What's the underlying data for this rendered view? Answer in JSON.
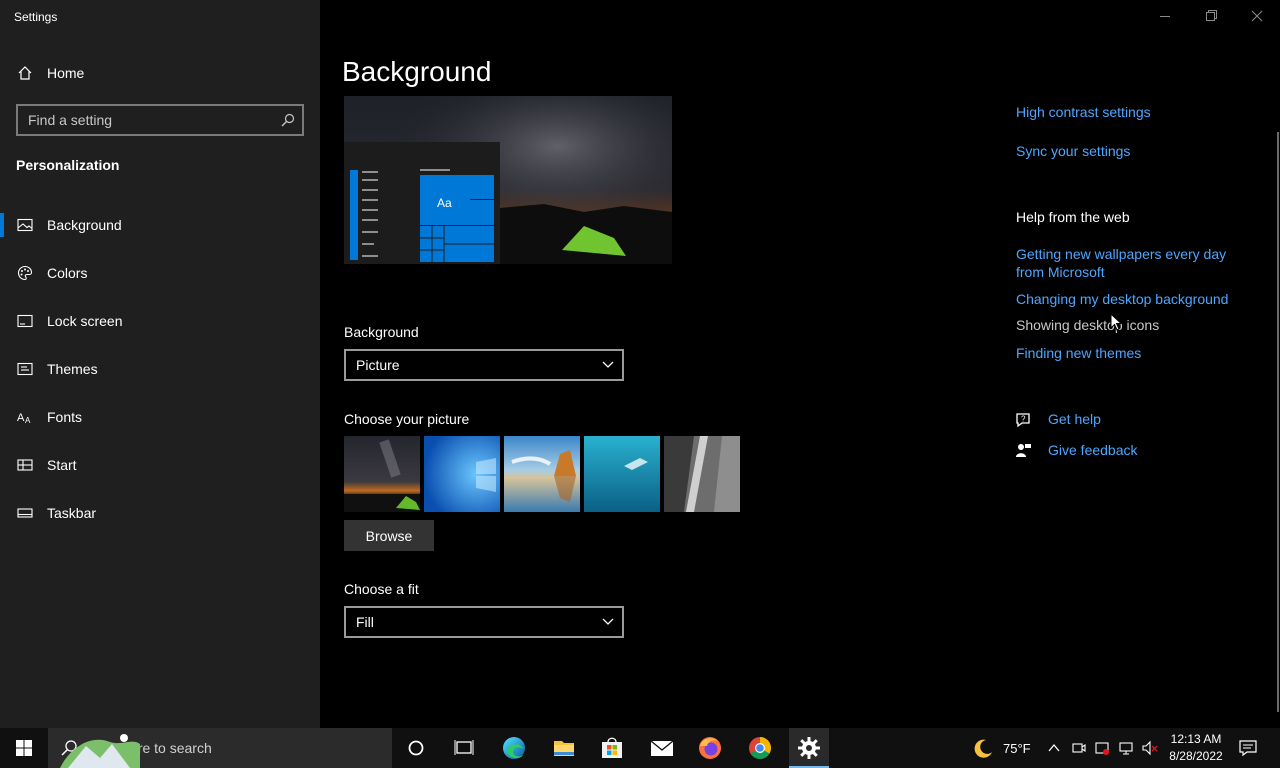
{
  "window": {
    "title": "Settings"
  },
  "sidebar": {
    "home_label": "Home",
    "search_placeholder": "Find a setting",
    "section_title": "Personalization",
    "items": [
      {
        "label": "Background",
        "icon": "picture-icon",
        "active": true
      },
      {
        "label": "Colors",
        "icon": "palette-icon"
      },
      {
        "label": "Lock screen",
        "icon": "lock-screen-icon"
      },
      {
        "label": "Themes",
        "icon": "brush-icon"
      },
      {
        "label": "Fonts",
        "icon": "fonts-icon"
      },
      {
        "label": "Start",
        "icon": "start-icon"
      },
      {
        "label": "Taskbar",
        "icon": "taskbar-icon"
      }
    ]
  },
  "main": {
    "title": "Background",
    "preview": {
      "tile_text": "Aa"
    },
    "background_label": "Background",
    "background_value": "Picture",
    "choose_picture_label": "Choose your picture",
    "browse_label": "Browse",
    "choose_fit_label": "Choose a fit",
    "fit_value": "Fill"
  },
  "related": {
    "high_contrast": "High contrast settings",
    "sync": "Sync your settings",
    "help_heading": "Help from the web",
    "web_links": [
      "Getting new wallpapers every day from Microsoft",
      "Changing my desktop background",
      "Showing desktop icons",
      "Finding new themes"
    ],
    "get_help": "Get help",
    "give_feedback": "Give feedback"
  },
  "taskbar": {
    "search_placeholder": "Type here to search",
    "weather": "75°F",
    "time": "12:13 AM",
    "date": "8/28/2022"
  },
  "colors": {
    "accent": "#0078d7",
    "link": "#4ea6ff"
  }
}
